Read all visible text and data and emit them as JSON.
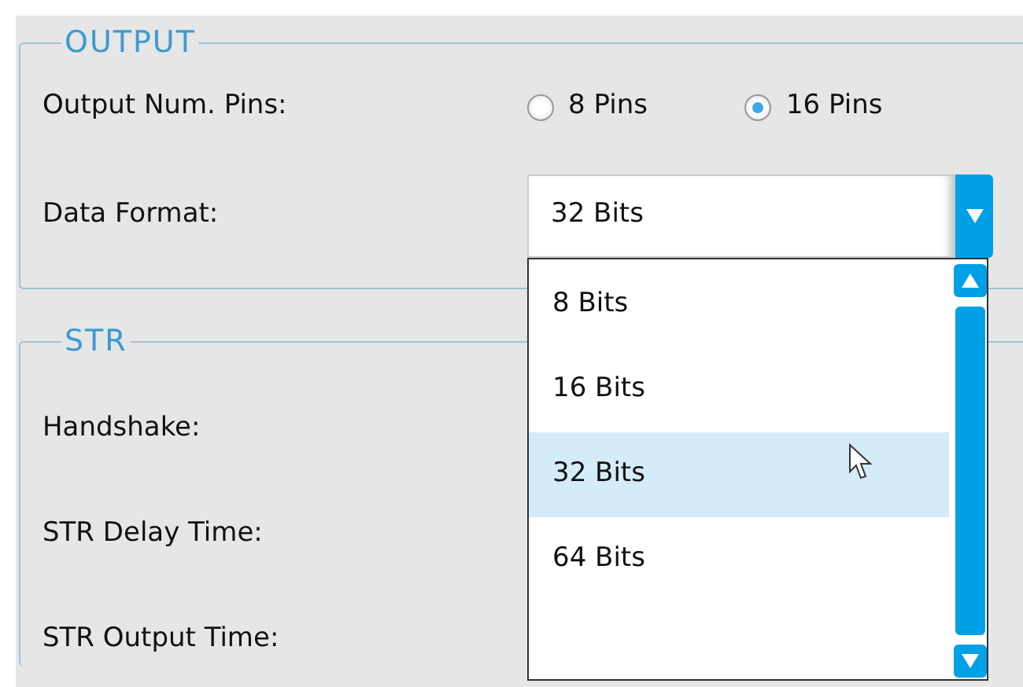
{
  "output": {
    "legend": "OUTPUT",
    "fields": [
      {
        "label": "Output Num. Pins:",
        "kind": "radio",
        "options": [
          {
            "label": "8 Pins",
            "selected": false
          },
          {
            "label": "16 Pins",
            "selected": true
          }
        ]
      },
      {
        "label": "Data Format:",
        "kind": "dropdown",
        "value": "32 Bits",
        "expanded": true,
        "options": [
          {
            "label": "8 Bits",
            "selected": false
          },
          {
            "label": "16 Bits",
            "selected": false
          },
          {
            "label": "32 Bits",
            "selected": true
          },
          {
            "label": "64 Bits",
            "selected": false
          }
        ]
      }
    ]
  },
  "str": {
    "legend": "STR",
    "fields": [
      {
        "label": "Handshake:"
      },
      {
        "label": "STR Delay Time:"
      },
      {
        "label": "STR Output Time:"
      }
    ]
  }
}
